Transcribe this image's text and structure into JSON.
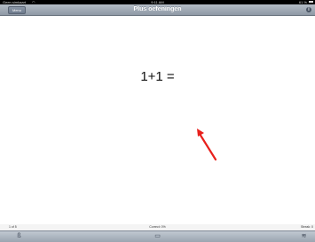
{
  "status_bar": {
    "carrier": "Geen simkaart",
    "time": "9:11 AM",
    "battery": "61 %"
  },
  "nav_bar": {
    "back_label": "Menu",
    "title": "Plus oefeningen",
    "info_glyph": "i"
  },
  "exercise": {
    "question": "1+1 ="
  },
  "annotation": {
    "arrow_color": "#e8201c"
  },
  "footer": {
    "page_info": "1 of 5",
    "score": "Correct: 0%",
    "streak": "Streak: 0"
  },
  "toolbar": {
    "left_icon": "restart-icon",
    "center_icon": "keyboard-icon",
    "right_icon": "settings-icon",
    "left_glyph": "ß",
    "center_glyph": "▭",
    "right_glyph": "≋"
  },
  "colors": {
    "nav_bar": "#9aa4b0",
    "background": "#ffffff"
  }
}
